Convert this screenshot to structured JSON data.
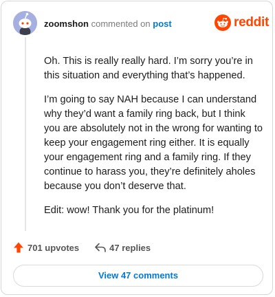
{
  "comment": {
    "username": "zoomshon",
    "action_text": "commented on",
    "post_link": "post",
    "body": [
      "Oh. This is really really hard. I’m sorry you’re in this situation and everything that’s happened.",
      "I’m going to say NAH because I can understand why they’d want a family ring back, but I think you are absolutely not in the wrong for wanting to keep your engagement ring either. It is equally your engagement ring and a family ring. If they continue to harass you, they’re definitely aholes because you don’t deserve that.",
      "Edit: wow! Thank you for the platinum!"
    ]
  },
  "brand": {
    "name": "reddit",
    "color": "#ff4500",
    "icon": "reddit-alien-icon"
  },
  "actions": {
    "upvotes": "701 upvotes",
    "upvote_icon": "upvote-arrow-icon",
    "upvote_color": "#ff4500",
    "replies": "47 replies",
    "reply_icon": "reply-arrow-icon"
  },
  "view_button": {
    "label": "View 47 comments",
    "color": "#0079d3"
  }
}
